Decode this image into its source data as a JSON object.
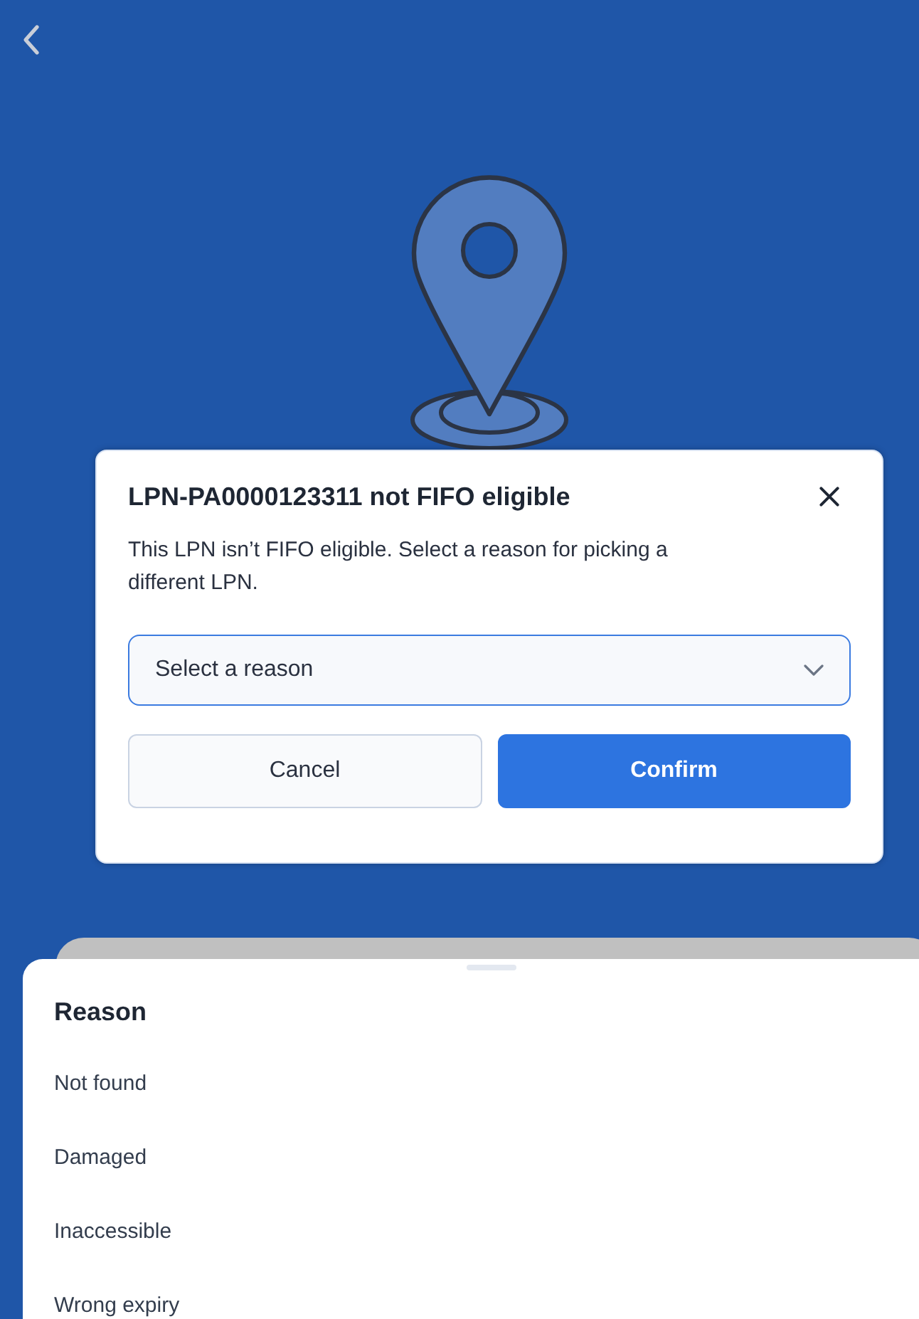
{
  "dialog": {
    "title": "LPN-PA0000123311 not FIFO eligible",
    "message": "This LPN isn’t FIFO eligible. Select a reason for picking a different LPN.",
    "reason_select": {
      "placeholder": "Select a reason",
      "focused": true
    },
    "buttons": [
      {
        "label": "Cancel",
        "kind": "secondary"
      },
      {
        "label": "Confirm",
        "kind": "primary"
      }
    ]
  },
  "reason_sheet": {
    "title": "Reason",
    "options": [
      {
        "label": "Not found"
      },
      {
        "label": "Damaged"
      },
      {
        "label": "Inaccessible"
      },
      {
        "label": "Wrong expiry"
      }
    ]
  }
}
